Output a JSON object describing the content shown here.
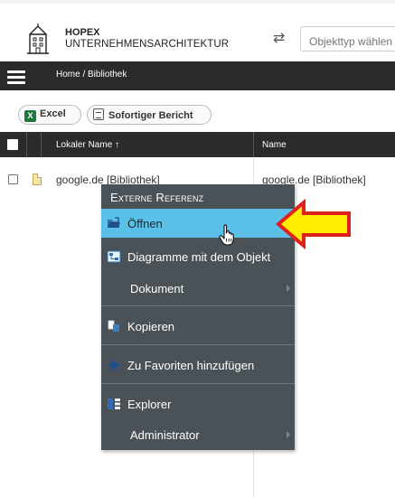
{
  "header": {
    "brand_line1": "HOPEX",
    "brand_line2": "UNTERNEHMENSARCHITEKTUR",
    "objtype_placeholder": "Objekttyp wählen",
    "swap_icon": "⇄"
  },
  "nav": {
    "breadcrumb": "Home / Bibliothek"
  },
  "toolbar": {
    "excel_icon": "X",
    "excel_label": "Excel",
    "report_label": "Sofortiger Bericht"
  },
  "table": {
    "columns": [
      "Lokaler Name ↑",
      "Name"
    ],
    "rows": [
      {
        "local_name": "google.de [Bibliothek]",
        "name": "google.de [Bibliothek]"
      }
    ]
  },
  "context_menu": {
    "title": "Externe Referenz",
    "items": [
      {
        "label": "Öffnen",
        "icon": "open-folder-icon",
        "submenu": false,
        "hover": true
      },
      {
        "label": "Diagramme mit dem Objekt",
        "icon": "diagram-icon",
        "submenu": false
      },
      {
        "label": "Dokument",
        "icon": "",
        "submenu": true
      },
      {
        "label": "Kopieren",
        "icon": "copy-icon",
        "submenu": false
      },
      {
        "label": "Zu Favoriten hinzufügen",
        "icon": "star-icon",
        "submenu": false
      },
      {
        "label": "Explorer",
        "icon": "explorer-icon",
        "submenu": false
      },
      {
        "label": "Administrator",
        "icon": "",
        "submenu": true
      }
    ]
  },
  "colors": {
    "navbar": "#2b2b2b",
    "menu_bg": "#4a5257",
    "menu_hover": "#5bc0e8",
    "annotation_arrow_fill": "#ffee00",
    "annotation_arrow_stroke": "#e0201a"
  }
}
